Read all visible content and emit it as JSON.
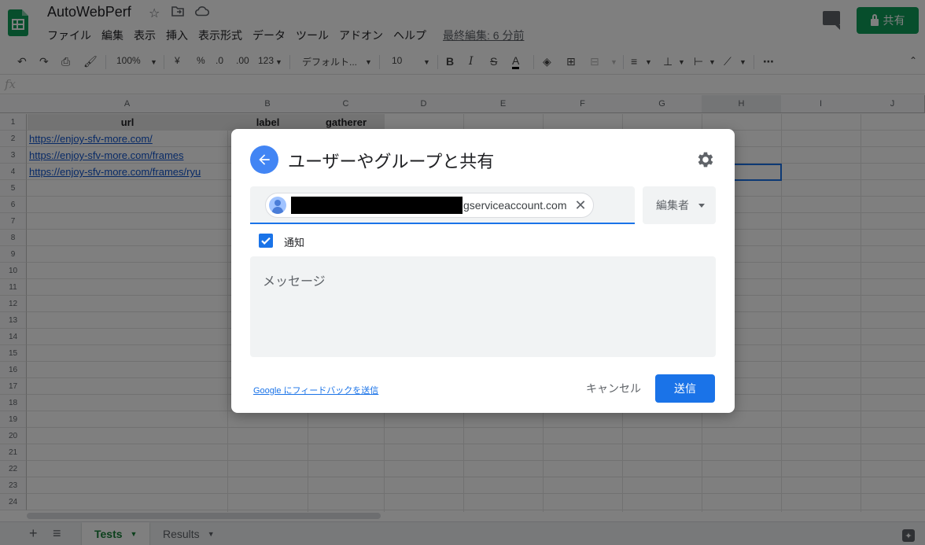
{
  "app": {
    "title": "AutoWebPerf",
    "star_icon": "star-icon",
    "move_icon": "folder-move-icon",
    "cloud_icon": "cloud-status-icon",
    "last_edit": "最終編集: 6 分前",
    "share_label": "共有",
    "brand_color": "#0f9d58"
  },
  "menu": {
    "items": [
      "ファイル",
      "編集",
      "表示",
      "挿入",
      "表示形式",
      "データ",
      "ツール",
      "アドオン",
      "ヘルプ"
    ]
  },
  "toolbar": {
    "zoom": "100%",
    "currency": "¥",
    "percent": "%",
    "dec_decrease": ".0",
    "dec_increase": ".00",
    "format_more": "123",
    "font": "デフォルト...",
    "font_size": "10",
    "bold": "B",
    "italic": "I",
    "strike": "S",
    "text_color": "A",
    "more": "⋯"
  },
  "formula": {
    "fx": "fx"
  },
  "grid": {
    "columns": [
      "A",
      "B",
      "C",
      "D",
      "E",
      "F",
      "G",
      "H",
      "I",
      "J"
    ],
    "rows": [
      "1",
      "2",
      "3",
      "4",
      "5",
      "6",
      "7",
      "8",
      "9",
      "10",
      "11",
      "12",
      "13",
      "14",
      "15",
      "16",
      "17",
      "18",
      "19",
      "20",
      "21",
      "22",
      "23",
      "24"
    ],
    "header_cells": {
      "a": "url",
      "b": "label",
      "c": "gatherer"
    },
    "links": [
      "https://enjoy-sfv-more.com/",
      "https://enjoy-sfv-more.com/frames",
      "https://enjoy-sfv-more.com/frames/ryu"
    ]
  },
  "sheets": {
    "tabs": [
      "Tests",
      "Results"
    ],
    "active": "Tests",
    "add_icon": "+",
    "list_icon": "≡"
  },
  "dialog": {
    "title": "ユーザーやグループと共有",
    "chip_text": "gserviceaccount.com",
    "role": "編集者",
    "notify_label": "通知",
    "notify_checked": true,
    "message_placeholder": "メッセージ",
    "feedback_link": "Google にフィードバックを送信",
    "cancel_label": "キャンセル",
    "send_label": "送信",
    "accent_color": "#1a73e8"
  }
}
